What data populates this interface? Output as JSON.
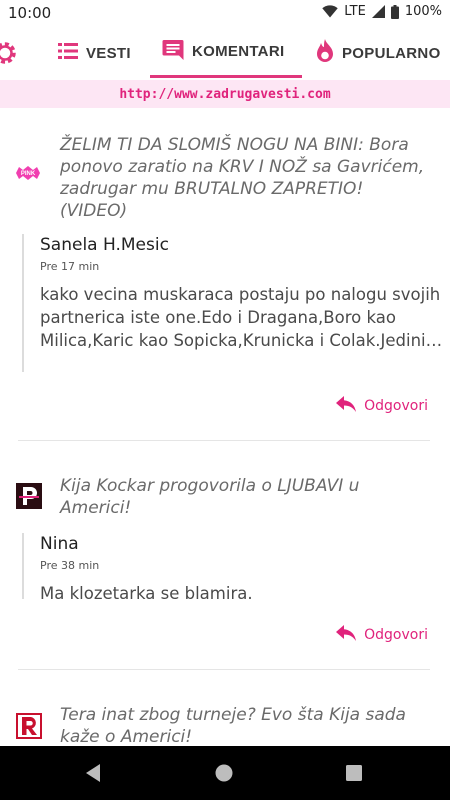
{
  "status_bar": {
    "time": "10:00",
    "network": "LTE",
    "battery": "100%"
  },
  "nav": {
    "tabs": [
      {
        "label": "VESTI",
        "icon": "list-icon"
      },
      {
        "label": "KOMENTARI",
        "icon": "comment-icon"
      },
      {
        "label": "POPULARNO",
        "icon": "flame-icon"
      }
    ],
    "active_tab": "KOMENTARI",
    "accent_color": "#e0377c"
  },
  "banner": {
    "url": "http://www.zadrugavesti.com"
  },
  "feed": [
    {
      "source_icon": "pink-source-logo",
      "title": "ŽELIM TI DA SLOMIŠ NOGU NA BINI: Bora ponovo zaratio na KRV I NOŽ sa Gavrićem, zadrugar mu BRUTALNO ZAPRETIO! (VIDEO)",
      "comment": {
        "author": "Sanela H.Mesic",
        "time": "Pre 17 min",
        "text": "kako vecina muskaraca postaju po nalogu svojih partnerica iste one.Edo i Dragana,Boro kao Milica,Karic kao Sopicka,Krunicka i Colak.Jedini pozitivci par Iva i Filip,sve ostalo…"
      },
      "reply_label": "Odgovori"
    },
    {
      "source_icon": "p-source-logo",
      "title": "Kija Kockar progovorila o LJUBAVI u Americi!",
      "comment": {
        "author": "Nina",
        "time": "Pre 38 min",
        "text": "Ma klozetarka se blamira."
      },
      "reply_label": "Odgovori"
    },
    {
      "source_icon": "r-source-logo",
      "title": "Tera inat zbog turneje? Evo šta Kija sada kaže o Americi!"
    }
  ]
}
